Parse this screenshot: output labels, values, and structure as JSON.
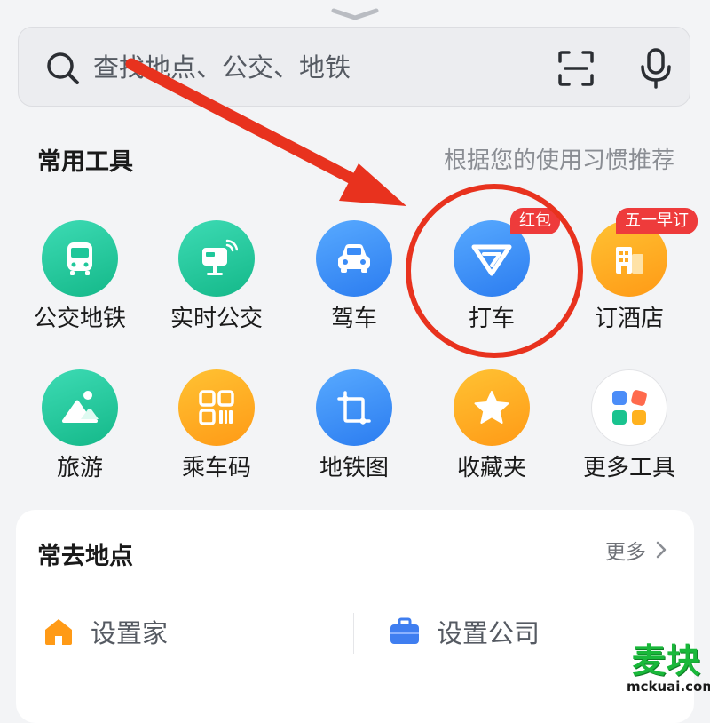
{
  "search": {
    "placeholder": "查找地点、公交、地铁"
  },
  "common_tools": {
    "title": "常用工具",
    "hint": "根据您的使用习惯推荐",
    "items": [
      {
        "label": "公交地铁",
        "icon": "bus-icon",
        "color": "#1fc79a"
      },
      {
        "label": "实时公交",
        "icon": "realtime-bus-stop-icon",
        "color": "#1fc79a"
      },
      {
        "label": "驾车",
        "icon": "car-icon",
        "color": "#3b8cf7"
      },
      {
        "label": "打车",
        "icon": "taxi-logo-icon",
        "color": "#3b8cf7",
        "badge": "红包"
      },
      {
        "label": "订酒店",
        "icon": "hotel-icon",
        "color": "#ffab21",
        "badge": "五一早订"
      },
      {
        "label": "旅游",
        "icon": "travel-icon",
        "color": "#1fc79a"
      },
      {
        "label": "乘车码",
        "icon": "qr-code-icon",
        "color": "#ffab21"
      },
      {
        "label": "地铁图",
        "icon": "subway-map-icon",
        "color": "#3b8cf7"
      },
      {
        "label": "收藏夹",
        "icon": "star-icon",
        "color": "#ffab21"
      },
      {
        "label": "更多工具",
        "icon": "more-tools-grid-icon",
        "color": "#ffffff"
      }
    ]
  },
  "frequent_places": {
    "title": "常去地点",
    "more_label": "更多",
    "home_label": "设置家",
    "company_label": "设置公司"
  },
  "colors": {
    "annotation_red": "#e8321e",
    "badge_red": "#ee3b3b",
    "watermark_green": "#19b83a"
  },
  "watermark": {
    "text": "麦块",
    "domain": "mckuai.com"
  }
}
